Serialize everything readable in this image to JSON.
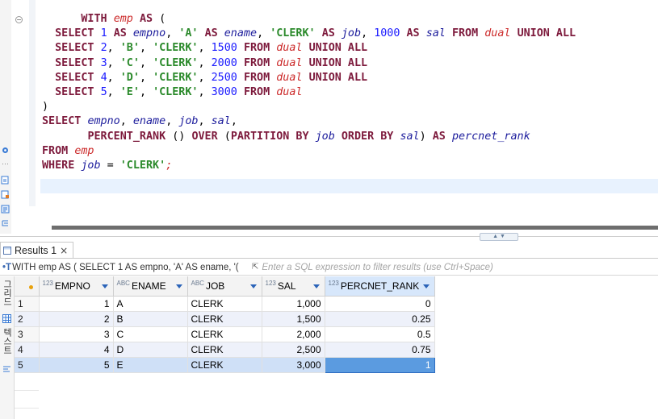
{
  "editor": {
    "lines": [
      [
        {
          "t": "      ",
          "c": "pl"
        },
        {
          "t": "WITH",
          "c": "kw"
        },
        {
          "t": " ",
          "c": "pl"
        },
        {
          "t": "emp",
          "c": "tbl"
        },
        {
          "t": " ",
          "c": "pl"
        },
        {
          "t": "AS",
          "c": "kw"
        },
        {
          "t": " (",
          "c": "pl"
        }
      ],
      [
        {
          "t": "  ",
          "c": "pl"
        },
        {
          "t": "SELECT",
          "c": "kw"
        },
        {
          "t": " ",
          "c": "pl"
        },
        {
          "t": "1",
          "c": "num"
        },
        {
          "t": " ",
          "c": "pl"
        },
        {
          "t": "AS",
          "c": "kw"
        },
        {
          "t": " ",
          "c": "pl"
        },
        {
          "t": "empno",
          "c": "id"
        },
        {
          "t": ", ",
          "c": "pl"
        },
        {
          "t": "'A'",
          "c": "str"
        },
        {
          "t": " ",
          "c": "pl"
        },
        {
          "t": "AS",
          "c": "kw"
        },
        {
          "t": " ",
          "c": "pl"
        },
        {
          "t": "ename",
          "c": "id"
        },
        {
          "t": ", ",
          "c": "pl"
        },
        {
          "t": "'CLERK'",
          "c": "str"
        },
        {
          "t": " ",
          "c": "pl"
        },
        {
          "t": "AS",
          "c": "kw"
        },
        {
          "t": " ",
          "c": "pl"
        },
        {
          "t": "job",
          "c": "id"
        },
        {
          "t": ", ",
          "c": "pl"
        },
        {
          "t": "1000",
          "c": "num"
        },
        {
          "t": " ",
          "c": "pl"
        },
        {
          "t": "AS",
          "c": "kw"
        },
        {
          "t": " ",
          "c": "pl"
        },
        {
          "t": "sal",
          "c": "id"
        },
        {
          "t": " ",
          "c": "pl"
        },
        {
          "t": "FROM",
          "c": "kw"
        },
        {
          "t": " ",
          "c": "pl"
        },
        {
          "t": "dual",
          "c": "tbl"
        },
        {
          "t": " ",
          "c": "pl"
        },
        {
          "t": "UNION ALL",
          "c": "kw"
        }
      ],
      [
        {
          "t": "  ",
          "c": "pl"
        },
        {
          "t": "SELECT",
          "c": "kw"
        },
        {
          "t": " ",
          "c": "pl"
        },
        {
          "t": "2",
          "c": "num"
        },
        {
          "t": ", ",
          "c": "pl"
        },
        {
          "t": "'B'",
          "c": "str"
        },
        {
          "t": ", ",
          "c": "pl"
        },
        {
          "t": "'CLERK'",
          "c": "str"
        },
        {
          "t": ", ",
          "c": "pl"
        },
        {
          "t": "1500",
          "c": "num"
        },
        {
          "t": " ",
          "c": "pl"
        },
        {
          "t": "FROM",
          "c": "kw"
        },
        {
          "t": " ",
          "c": "pl"
        },
        {
          "t": "dual",
          "c": "tbl"
        },
        {
          "t": " ",
          "c": "pl"
        },
        {
          "t": "UNION ALL",
          "c": "kw"
        }
      ],
      [
        {
          "t": "  ",
          "c": "pl"
        },
        {
          "t": "SELECT",
          "c": "kw"
        },
        {
          "t": " ",
          "c": "pl"
        },
        {
          "t": "3",
          "c": "num"
        },
        {
          "t": ", ",
          "c": "pl"
        },
        {
          "t": "'C'",
          "c": "str"
        },
        {
          "t": ", ",
          "c": "pl"
        },
        {
          "t": "'CLERK'",
          "c": "str"
        },
        {
          "t": ", ",
          "c": "pl"
        },
        {
          "t": "2000",
          "c": "num"
        },
        {
          "t": " ",
          "c": "pl"
        },
        {
          "t": "FROM",
          "c": "kw"
        },
        {
          "t": " ",
          "c": "pl"
        },
        {
          "t": "dual",
          "c": "tbl"
        },
        {
          "t": " ",
          "c": "pl"
        },
        {
          "t": "UNION ALL",
          "c": "kw"
        }
      ],
      [
        {
          "t": "  ",
          "c": "pl"
        },
        {
          "t": "SELECT",
          "c": "kw"
        },
        {
          "t": " ",
          "c": "pl"
        },
        {
          "t": "4",
          "c": "num"
        },
        {
          "t": ", ",
          "c": "pl"
        },
        {
          "t": "'D'",
          "c": "str"
        },
        {
          "t": ", ",
          "c": "pl"
        },
        {
          "t": "'CLERK'",
          "c": "str"
        },
        {
          "t": ", ",
          "c": "pl"
        },
        {
          "t": "2500",
          "c": "num"
        },
        {
          "t": " ",
          "c": "pl"
        },
        {
          "t": "FROM",
          "c": "kw"
        },
        {
          "t": " ",
          "c": "pl"
        },
        {
          "t": "dual",
          "c": "tbl"
        },
        {
          "t": " ",
          "c": "pl"
        },
        {
          "t": "UNION ALL",
          "c": "kw"
        }
      ],
      [
        {
          "t": "  ",
          "c": "pl"
        },
        {
          "t": "SELECT",
          "c": "kw"
        },
        {
          "t": " ",
          "c": "pl"
        },
        {
          "t": "5",
          "c": "num"
        },
        {
          "t": ", ",
          "c": "pl"
        },
        {
          "t": "'E'",
          "c": "str"
        },
        {
          "t": ", ",
          "c": "pl"
        },
        {
          "t": "'CLERK'",
          "c": "str"
        },
        {
          "t": ", ",
          "c": "pl"
        },
        {
          "t": "3000",
          "c": "num"
        },
        {
          "t": " ",
          "c": "pl"
        },
        {
          "t": "FROM",
          "c": "kw"
        },
        {
          "t": " ",
          "c": "pl"
        },
        {
          "t": "dual",
          "c": "tbl"
        }
      ],
      [
        {
          "t": ")",
          "c": "pl"
        }
      ],
      [
        {
          "t": "SELECT",
          "c": "kw"
        },
        {
          "t": " ",
          "c": "pl"
        },
        {
          "t": "empno",
          "c": "id"
        },
        {
          "t": ", ",
          "c": "pl"
        },
        {
          "t": "ename",
          "c": "id"
        },
        {
          "t": ", ",
          "c": "pl"
        },
        {
          "t": "job",
          "c": "id"
        },
        {
          "t": ", ",
          "c": "pl"
        },
        {
          "t": "sal",
          "c": "id"
        },
        {
          "t": ",",
          "c": "pl"
        }
      ],
      [
        {
          "t": "       ",
          "c": "pl"
        },
        {
          "t": "PERCENT_RANK",
          "c": "kw"
        },
        {
          "t": " () ",
          "c": "pl"
        },
        {
          "t": "OVER",
          "c": "kw"
        },
        {
          "t": " (",
          "c": "pl"
        },
        {
          "t": "PARTITION BY",
          "c": "kw"
        },
        {
          "t": " ",
          "c": "pl"
        },
        {
          "t": "job",
          "c": "id"
        },
        {
          "t": " ",
          "c": "pl"
        },
        {
          "t": "ORDER BY",
          "c": "kw"
        },
        {
          "t": " ",
          "c": "pl"
        },
        {
          "t": "sal",
          "c": "id"
        },
        {
          "t": ") ",
          "c": "pl"
        },
        {
          "t": "AS",
          "c": "kw"
        },
        {
          "t": " ",
          "c": "pl"
        },
        {
          "t": "percnet_rank",
          "c": "al"
        }
      ],
      [
        {
          "t": "FROM",
          "c": "kw"
        },
        {
          "t": " ",
          "c": "pl"
        },
        {
          "t": "emp",
          "c": "tbl"
        }
      ],
      [
        {
          "t": "WHERE",
          "c": "kw"
        },
        {
          "t": " ",
          "c": "pl"
        },
        {
          "t": "job",
          "c": "id"
        },
        {
          "t": " = ",
          "c": "pl"
        },
        {
          "t": "'CLERK'",
          "c": "str"
        },
        {
          "t": ";",
          "c": "tbl"
        }
      ]
    ]
  },
  "results": {
    "tab_label": "Results 1",
    "close_glyph": "×",
    "query_icon": "•T",
    "query_text": "WITH emp AS ( SELECT 1 AS empno, 'A' AS ename, '(",
    "filter_placeholder": "Enter a SQL expression to filter results (use Ctrl+Space)",
    "columns": [
      {
        "type_prefix": "123",
        "name": "EMPNO",
        "align": "r",
        "selected": false
      },
      {
        "type_prefix": "ABC",
        "name": "ENAME",
        "align": "l",
        "selected": false
      },
      {
        "type_prefix": "ABC",
        "name": "JOB",
        "align": "l",
        "selected": false
      },
      {
        "type_prefix": "123",
        "name": "SAL",
        "align": "r",
        "selected": false
      },
      {
        "type_prefix": "123",
        "name": "PERCNET_RANK",
        "align": "r",
        "selected": true
      }
    ],
    "rows": [
      [
        "1",
        "1",
        "A",
        "CLERK",
        "1,000",
        "0"
      ],
      [
        "2",
        "2",
        "B",
        "CLERK",
        "1,500",
        "0.25"
      ],
      [
        "3",
        "3",
        "C",
        "CLERK",
        "2,000",
        "0.5"
      ],
      [
        "4",
        "4",
        "D",
        "CLERK",
        "2,500",
        "0.75"
      ],
      [
        "5",
        "5",
        "E",
        "CLERK",
        "3,000",
        "1"
      ]
    ],
    "current_row": 4,
    "side_tabs": [
      "그리드",
      "텍스트"
    ]
  },
  "colors": {
    "keyword": "#7d1a3c",
    "string": "#2b8a2b",
    "number": "#1a1aff",
    "identifier": "#1c1c9c",
    "table": "#cc2a2a",
    "selection": "#5b9be0"
  }
}
